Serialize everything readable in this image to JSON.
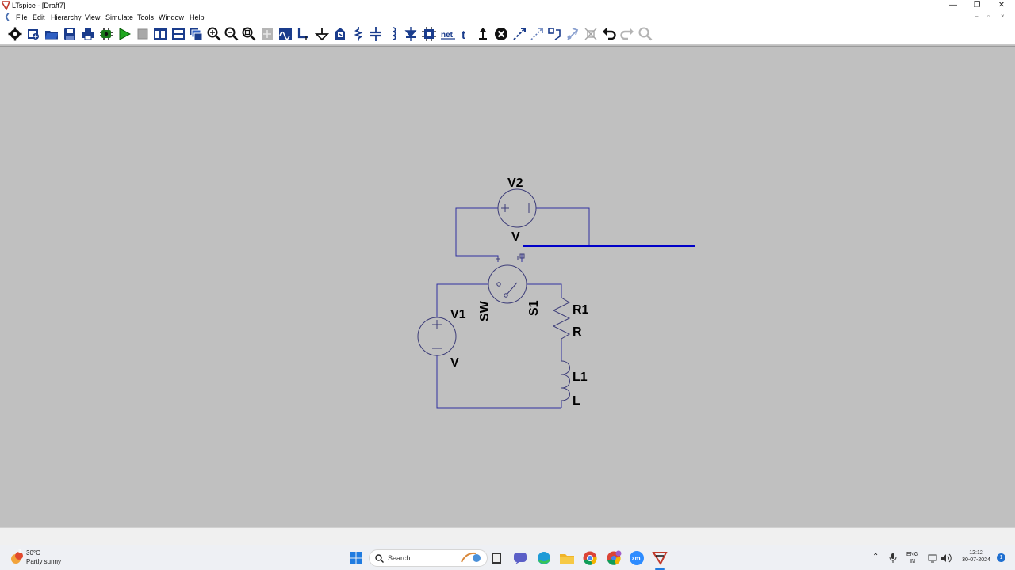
{
  "window": {
    "title": "LTspice - [Draft7]",
    "minimize_glyph": "—",
    "maximize_glyph": "❐",
    "close_glyph": "✕"
  },
  "menubar": {
    "items": [
      "File",
      "Edit",
      "Hierarchy",
      "View",
      "Simulate",
      "Tools",
      "Window",
      "Help"
    ]
  },
  "toolbar": {
    "tools": [
      {
        "name": "control-panel",
        "icon": "gear-icon"
      },
      {
        "name": "new-schematic",
        "icon": "new-schematic-icon"
      },
      {
        "name": "open",
        "icon": "open-folder-icon"
      },
      {
        "name": "save",
        "icon": "save-icon"
      },
      {
        "name": "print",
        "icon": "printer-icon"
      },
      {
        "name": "cpu-simulate",
        "icon": "chip-icon"
      },
      {
        "name": "run",
        "icon": "run-icon"
      },
      {
        "name": "halt",
        "icon": "halt-icon"
      },
      {
        "name": "tile-vertical",
        "icon": "tile-vertical-icon"
      },
      {
        "name": "tile-horizontal",
        "icon": "tile-horizontal-icon"
      },
      {
        "name": "cascade",
        "icon": "cascade-icon"
      },
      {
        "name": "zoom-in",
        "icon": "zoom-in-icon"
      },
      {
        "name": "zoom-out",
        "icon": "zoom-out-icon"
      },
      {
        "name": "zoom-fit",
        "icon": "zoom-fit-icon"
      },
      {
        "name": "pan",
        "icon": "pan-icon"
      },
      {
        "name": "waveform",
        "icon": "waveform-icon"
      },
      {
        "name": "wire",
        "icon": "wire-icon"
      },
      {
        "name": "ground",
        "icon": "ground-icon"
      },
      {
        "name": "label-net",
        "icon": "label-net-icon"
      },
      {
        "name": "resistor",
        "icon": "resistor-icon"
      },
      {
        "name": "capacitor",
        "icon": "capacitor-icon"
      },
      {
        "name": "inductor",
        "icon": "inductor-icon"
      },
      {
        "name": "diode",
        "icon": "diode-icon"
      },
      {
        "name": "component",
        "icon": "component-icon"
      },
      {
        "name": "spice-directive",
        "icon": "spice-directive-icon"
      },
      {
        "name": "text",
        "icon": "text-icon"
      },
      {
        "name": "move",
        "icon": "move-icon"
      },
      {
        "name": "delete",
        "icon": "delete-icon"
      },
      {
        "name": "drag",
        "icon": "drag-icon"
      },
      {
        "name": "duplicate",
        "icon": "duplicate-icon"
      },
      {
        "name": "rotate",
        "icon": "rotate-icon"
      },
      {
        "name": "mirror",
        "icon": "mirror-icon"
      },
      {
        "name": "pick-visible",
        "icon": "pick-visible-icon"
      },
      {
        "name": "undo",
        "icon": "undo-icon"
      },
      {
        "name": "redo",
        "icon": "redo-icon"
      },
      {
        "name": "find",
        "icon": "find-icon"
      }
    ],
    "net_label": "net",
    "text_label": "t"
  },
  "schematic": {
    "colors": {
      "wire": "#3030a0",
      "component": "#3c3c78",
      "selected_wire": "#0000c8",
      "text": "#000000"
    },
    "labels": {
      "v2_name": "V2",
      "v2_value": "V",
      "v1_name": "V1",
      "v1_value": "V",
      "sw_model": "SW",
      "s1_name": "S1",
      "r1_name": "R1",
      "r1_value": "R",
      "l1_name": "L1",
      "l1_value": "L",
      "plus_sign": "+",
      "minus_sign": "−"
    }
  },
  "taskbar": {
    "weather_temp": "30°C",
    "weather_desc": "Partly sunny",
    "weather_badge": "1",
    "search_label": "Search",
    "zoom_label": "zm",
    "lang_top": "ENG",
    "lang_bottom": "IN",
    "time": "12:12",
    "date": "30-07-2024",
    "notify_count": "1"
  }
}
